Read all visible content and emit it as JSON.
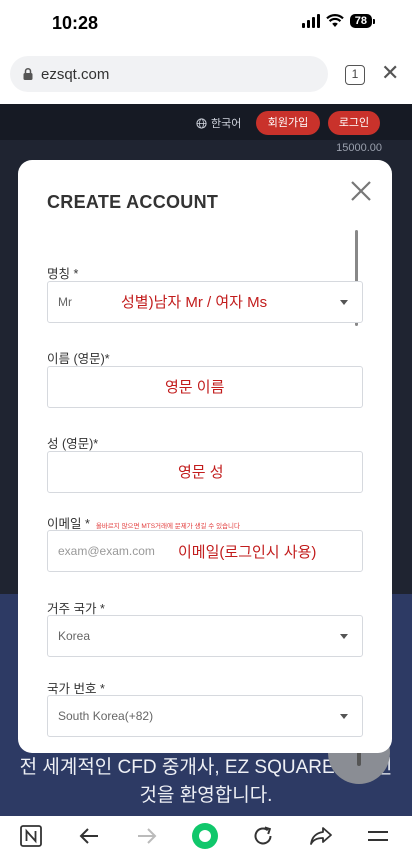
{
  "status_bar": {
    "time": "10:28",
    "battery": "78"
  },
  "browser": {
    "url": "ezsqt.com",
    "tab_count": "1"
  },
  "site": {
    "language": "한국어",
    "join_label": "회원가입",
    "login_label": "로그인",
    "price_ticker": "15000.00",
    "tagline_line1": "전 세계적인 CFD 중개사, EZ SQUARE에 오신",
    "tagline_line2": "것을 환영합니다."
  },
  "modal": {
    "title": "CREATE ACCOUNT",
    "fields": {
      "title": {
        "label": "명칭 *",
        "value": "Mr",
        "note": "성별)남자 Mr / 여자 Ms"
      },
      "first_name": {
        "label": "이름 (영문)*",
        "value": "",
        "note": "영문 이름"
      },
      "last_name": {
        "label": "성 (영문)*",
        "value": "",
        "note": "영문 성"
      },
      "email": {
        "label": "이메일 *",
        "hint": "올바르지 않으면 MTS거래에 문제가 생길 수 있습니다",
        "placeholder": "exam@exam.com",
        "note": "이메일(로그인시 사용)"
      },
      "country": {
        "label": "거주 국가 *",
        "value": "Korea"
      },
      "phone_code": {
        "label": "국가 번호 *",
        "value": "South Korea(+82)"
      }
    }
  },
  "colors": {
    "accent_red": "#c9322b",
    "note_red": "#c21d1d"
  }
}
